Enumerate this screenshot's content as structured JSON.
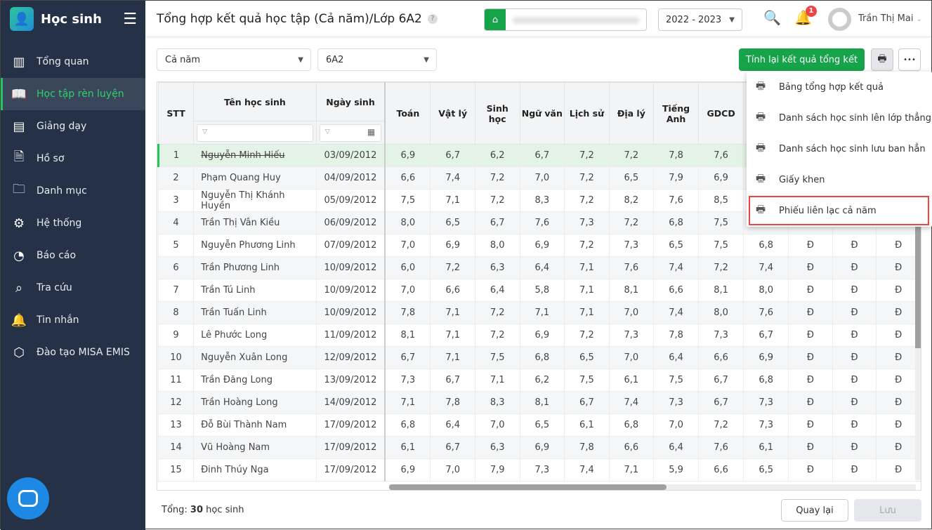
{
  "sidebar": {
    "brand": "Học sinh",
    "items": [
      {
        "label": "Tổng quan",
        "icon": "bar-chart-icon"
      },
      {
        "label": "Học tập rèn luyện",
        "icon": "book-icon",
        "active": true
      },
      {
        "label": "Giảng dạy",
        "icon": "board-icon"
      },
      {
        "label": "Hồ sơ",
        "icon": "document-icon"
      },
      {
        "label": "Danh mục",
        "icon": "folder-icon"
      },
      {
        "label": "Hệ thống",
        "icon": "gear-icon"
      },
      {
        "label": "Báo cáo",
        "icon": "pie-chart-icon"
      },
      {
        "label": "Tra cứu",
        "icon": "search-icon"
      },
      {
        "label": "Tin nhắn",
        "icon": "bell-icon"
      },
      {
        "label": "Đào tạo MISA EMIS",
        "icon": "cube-icon"
      }
    ]
  },
  "header": {
    "title": "Tổng hợp kết quả học tập (Cả năm)/Lớp 6A2",
    "help": "?",
    "year": "2022 - 2023",
    "notifications": "1",
    "user": "Trần Thị Mai"
  },
  "toolbar": {
    "period": "Cả năm",
    "class": "6A2",
    "recalc": "Tính lại kết quả tổng kết",
    "more": "•••"
  },
  "menu": [
    "Bảng tổng hợp kết quả",
    "Danh sách học sinh lên lớp thẳng",
    "Danh sách học sinh lưu ban hẳn",
    "Giấy khen",
    "Phiếu liên lạc cả năm"
  ],
  "table": {
    "headers": [
      "STT",
      "Tên học sinh",
      "Ngày sinh",
      "Toán",
      "Vật lý",
      "Sinh học",
      "Ngữ văn",
      "Lịch sử",
      "Địa lý",
      "Tiếng Anh",
      "GDCD",
      "",
      "",
      "",
      ""
    ],
    "rows": [
      [
        "1",
        "Nguyễn Minh Hiếu",
        "03/09/2012",
        "6,9",
        "6,7",
        "6,2",
        "6,7",
        "7,2",
        "7,2",
        "7,8",
        "7,6",
        "",
        "",
        "",
        ""
      ],
      [
        "2",
        "Phạm Quang Huy",
        "04/09/2012",
        "6,6",
        "7,4",
        "7,2",
        "7,0",
        "7,2",
        "6,5",
        "7,9",
        "6,9",
        "",
        "",
        "",
        ""
      ],
      [
        "3",
        "Nguyễn Thị Khánh Huyền",
        "05/09/2012",
        "7,5",
        "7,1",
        "7,2",
        "8,3",
        "7,2",
        "8,2",
        "7,6",
        "8,5",
        "",
        "",
        "",
        ""
      ],
      [
        "4",
        "Trần Thị Vân Kiều",
        "06/09/2012",
        "8,0",
        "6,5",
        "6,7",
        "7,6",
        "7,3",
        "7,2",
        "6,8",
        "7,5",
        "",
        "",
        "",
        ""
      ],
      [
        "5",
        "Nguyễn Phương Linh",
        "07/09/2012",
        "7,0",
        "6,9",
        "8,0",
        "6,9",
        "7,2",
        "7,3",
        "6,5",
        "7,5",
        "6,8",
        "Đ",
        "Đ",
        "Đ"
      ],
      [
        "6",
        "Trần Phương Linh",
        "10/09/2012",
        "6,0",
        "7,2",
        "6,3",
        "6,4",
        "7,1",
        "7,6",
        "7,4",
        "7,2",
        "7,4",
        "Đ",
        "Đ",
        "Đ"
      ],
      [
        "7",
        "Trần Tú Linh",
        "10/09/2012",
        "7,0",
        "6,6",
        "6,4",
        "5,8",
        "7,1",
        "8,1",
        "6,6",
        "8,1",
        "8,0",
        "Đ",
        "Đ",
        "Đ"
      ],
      [
        "8",
        "Trần Tuấn Linh",
        "10/09/2012",
        "7,8",
        "7,1",
        "7,2",
        "7,1",
        "7,1",
        "7,0",
        "7,4",
        "8,0",
        "7,6",
        "Đ",
        "Đ",
        "Đ"
      ],
      [
        "9",
        "Lê Phước Long",
        "11/09/2012",
        "8,1",
        "7,1",
        "7,2",
        "6,9",
        "7,2",
        "7,3",
        "7,8",
        "7,3",
        "6,7",
        "Đ",
        "Đ",
        "Đ"
      ],
      [
        "10",
        "Nguyễn Xuân Long",
        "12/09/2012",
        "6,7",
        "7,1",
        "7,5",
        "6,8",
        "6,5",
        "7,0",
        "6,4",
        "6,6",
        "6,9",
        "Đ",
        "Đ",
        "Đ"
      ],
      [
        "11",
        "Trần Đăng Long",
        "13/09/2012",
        "7,3",
        "6,7",
        "7,1",
        "6,2",
        "7,5",
        "6,1",
        "7,5",
        "6,7",
        "6,8",
        "Đ",
        "Đ",
        "Đ"
      ],
      [
        "12",
        "Trần Hoàng Long",
        "14/09/2012",
        "7,1",
        "7,8",
        "8,3",
        "8,1",
        "6,7",
        "7,4",
        "7,3",
        "6,7",
        "7,3",
        "Đ",
        "Đ",
        "Đ"
      ],
      [
        "13",
        "Đỗ Bùi Thành Nam",
        "17/09/2012",
        "6,8",
        "6,4",
        "7,0",
        "6,5",
        "6,1",
        "6,8",
        "7,0",
        "7,2",
        "7,3",
        "Đ",
        "Đ",
        "Đ"
      ],
      [
        "14",
        "Vũ Hoàng Nam",
        "17/09/2012",
        "6,1",
        "6,7",
        "6,3",
        "6,9",
        "7,8",
        "6,6",
        "6,4",
        "7,6",
        "6,1",
        "Đ",
        "Đ",
        "Đ"
      ],
      [
        "15",
        "Đinh Thúy Nga",
        "17/09/2012",
        "6,9",
        "7,0",
        "7,9",
        "7,3",
        "7,4",
        "7,1",
        "5,9",
        "6,6",
        "6,5",
        "Đ",
        "Đ",
        "Đ"
      ]
    ]
  },
  "footer": {
    "total_label": "Tổng:",
    "total_value": "30",
    "total_unit": "học sinh",
    "back": "Quay lại",
    "save": "Lưu"
  }
}
